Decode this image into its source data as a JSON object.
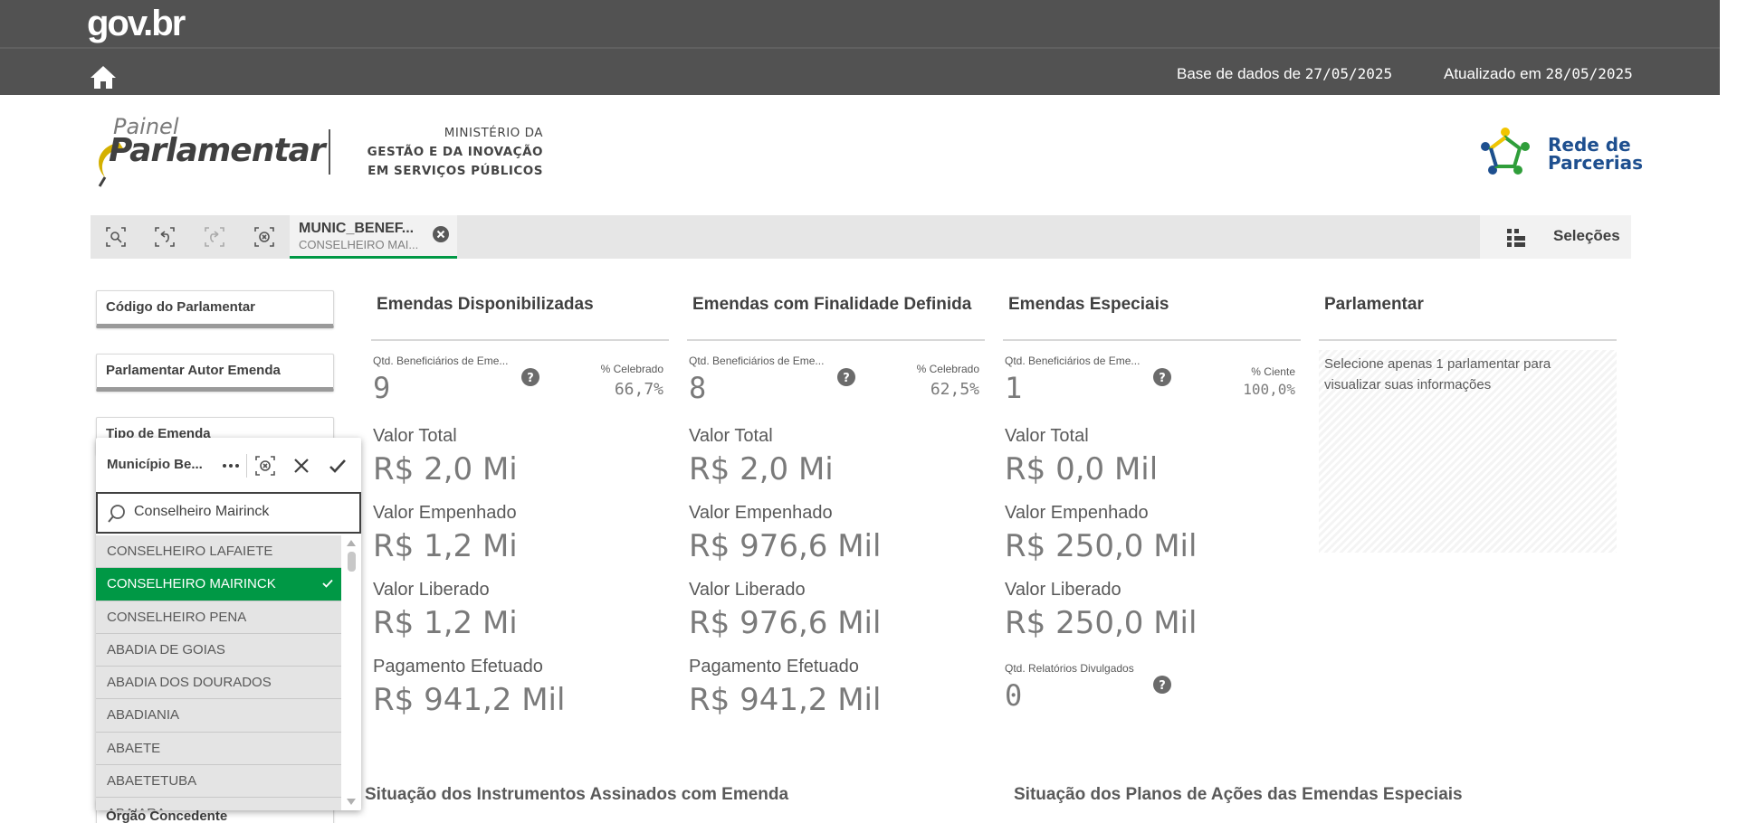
{
  "header": {
    "brand": "gov.br",
    "db_label": "Base de dados de",
    "db_date": "27/05/2025",
    "updated_label": "Atualizado em",
    "updated_date": "28/05/2025",
    "colors": {
      "band": "#525252",
      "accent": "#009845"
    }
  },
  "logos": {
    "painel_small": "Painel",
    "painel_big": "Parlamentar",
    "ministry_line1": "MINISTÉRIO DA",
    "ministry_line2": "GESTÃO E DA INOVAÇÃO",
    "ministry_line3": "EM SERVIÇOS PÚBLICOS",
    "rede_line1": "Rede de",
    "rede_line2": "Parcerias"
  },
  "selections_bar": {
    "tools": [
      "smart-search-icon",
      "step-back-icon",
      "step-forward-icon",
      "clear-all-icon"
    ],
    "chip_title": "MUNIC_BENEF...",
    "chip_value": "CONSELHEIRO MAI...",
    "selections_label": "Seleções"
  },
  "filters": {
    "codigo": "Código do Parlamentar",
    "autor": "Parlamentar Autor Emenda",
    "tipo": "Tipo de Emenda",
    "orgao": "Órgão Concedente"
  },
  "popup": {
    "title": "Município Be...",
    "search_value": "Conselheiro Mairinck",
    "items": [
      {
        "label": "CONSELHEIRO LAFAIETE",
        "selected": false
      },
      {
        "label": "CONSELHEIRO MAIRINCK",
        "selected": true
      },
      {
        "label": "CONSELHEIRO PENA",
        "selected": false
      },
      {
        "label": "ABADIA DE GOIAS",
        "selected": false
      },
      {
        "label": "ABADIA DOS DOURADOS",
        "selected": false
      },
      {
        "label": "ABADIANIA",
        "selected": false
      },
      {
        "label": "ABAETE",
        "selected": false
      },
      {
        "label": "ABAETETUBA",
        "selected": false
      },
      {
        "label": "ABAIARA",
        "selected": false
      }
    ]
  },
  "columns": [
    {
      "title": "Emendas Disponibilizadas",
      "qtd_label": "Qtd. Beneficiários de Eme...",
      "qtd_value": "9",
      "pct_label": "% Celebrado",
      "pct_value": "66,7%",
      "kpis": [
        {
          "label": "Valor Total",
          "value": "R$ 2,0 Mi"
        },
        {
          "label": "Valor Empenhado",
          "value": "R$ 1,2 Mi"
        },
        {
          "label": "Valor Liberado",
          "value": "R$ 1,2 Mi"
        },
        {
          "label": "Pagamento Efetuado",
          "value": "R$ 941,2 Mil"
        }
      ]
    },
    {
      "title": "Emendas com Finalidade Definida",
      "qtd_label": "Qtd. Beneficiários de Eme...",
      "qtd_value": "8",
      "pct_label": "% Celebrado",
      "pct_value": "62,5%",
      "kpis": [
        {
          "label": "Valor Total",
          "value": "R$ 2,0 Mi"
        },
        {
          "label": "Valor Empenhado",
          "value": "R$ 976,6 Mil"
        },
        {
          "label": "Valor Liberado",
          "value": "R$ 976,6 Mil"
        },
        {
          "label": "Pagamento Efetuado",
          "value": "R$ 941,2 Mil"
        }
      ]
    },
    {
      "title": "Emendas Especiais",
      "qtd_label": "Qtd. Beneficiários de Eme...",
      "qtd_value": "1",
      "pct_label": "% Ciente",
      "pct_value": "100,0%",
      "kpis": [
        {
          "label": "Valor Total",
          "value": "R$ 0,0 Mil"
        },
        {
          "label": "Valor Empenhado",
          "value": "R$ 250,0 Mil"
        },
        {
          "label": "Valor Liberado",
          "value": "R$ 250,0 Mil"
        }
      ],
      "rel_label": "Qtd. Relatórios Divulgados",
      "rel_value": "0"
    },
    {
      "title": "Parlamentar",
      "message": "Selecione apenas 1 parlamentar para visualizar suas informações"
    }
  ],
  "sections": {
    "instrumentos": "Situação dos Instrumentos Assinados com Emenda",
    "planos": "Situação dos Planos de Ações das Emendas Especiais"
  }
}
